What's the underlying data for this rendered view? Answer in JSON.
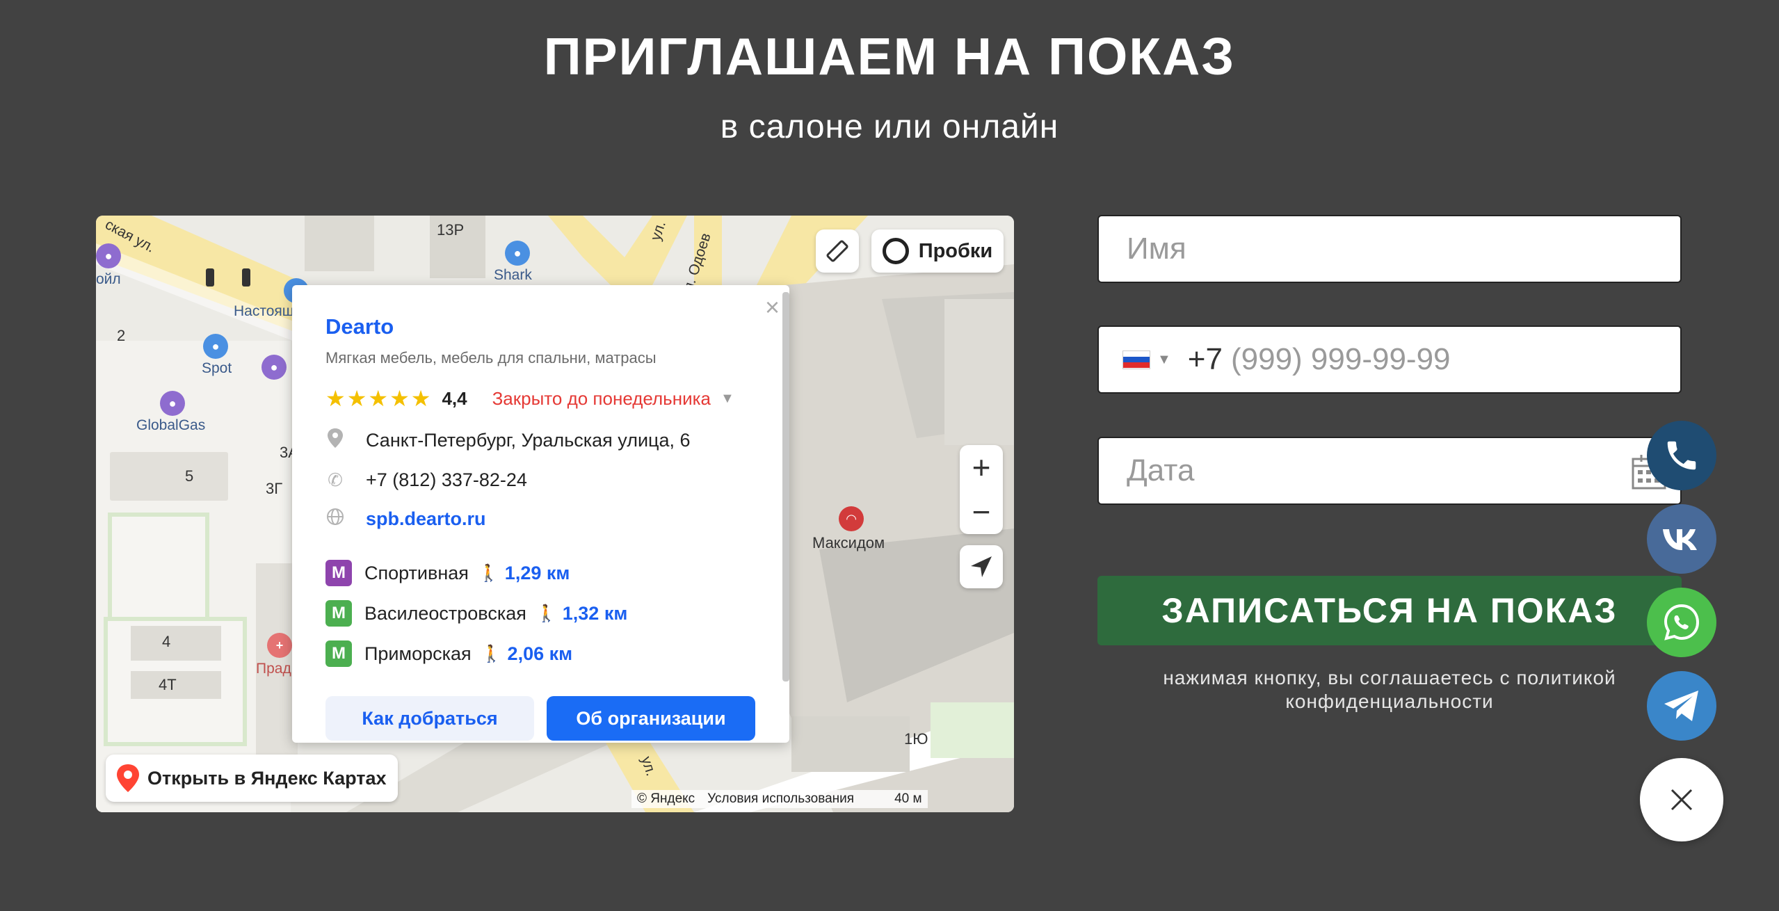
{
  "header": {
    "title": "ПРИГЛАШАЕМ НА ПОКАЗ",
    "subtitle": "в салоне или онлайн"
  },
  "map": {
    "traffic_label": "Пробки",
    "zoom_in": "+",
    "zoom_out": "−",
    "open_in_maps": "Открыть в Яндекс Картах",
    "copyright": "© Яндекс",
    "terms": "Условия использования",
    "scale": "40 м",
    "labels": {
      "street1": "ская ул.",
      "street2": "ул. Одоев",
      "street3": "ул.",
      "street4": "ул.",
      "b13p": "13Р",
      "shark": "Shark",
      "nastoyash": "Настоящ",
      "spot": "Spot",
      "globalgas": "GlobalGas",
      "b2": "2",
      "b5": "5",
      "b3a": "3А",
      "b3g": "3Г",
      "b4": "4",
      "b4t": "4Т",
      "prad": "Прад",
      "maxidom": "Максидом",
      "b1yu": "1Ю",
      "oil": "ойл"
    },
    "card": {
      "name": "Dearto",
      "category": "Мягкая мебель, мебель для спальни, матрасы",
      "rating": "4,4",
      "stars": "★★★★★",
      "status": "Закрыто до понедельника",
      "address": "Санкт-Петербург, Уральская улица, 6",
      "phone": "+7 (812) 337-82-24",
      "site": "spb.dearto.ru",
      "metro": [
        {
          "badge": "М",
          "name": "Спортивная",
          "distance": "1,29 км",
          "color": "#8e44ad"
        },
        {
          "badge": "М",
          "name": "Василеостровская",
          "distance": "1,32 км",
          "color": "#4caf50"
        },
        {
          "badge": "М",
          "name": "Приморская",
          "distance": "2,06 км",
          "color": "#4caf50"
        }
      ],
      "route_button": "Как добраться",
      "about_button": "Об организации"
    }
  },
  "form": {
    "name_placeholder": "Имя",
    "phone_prefix": "+7",
    "phone_placeholder": "(999) 999-99-99",
    "date_placeholder": "Дата",
    "submit_label": "ЗАПИСАТЬСЯ НА ПОКАЗ",
    "consent": "нажимая кнопку, вы соглашаетесь с политикой конфиденциальности"
  },
  "colors": {
    "background": "#424242",
    "submit": "#2e6b3d",
    "link": "#1a5ff0",
    "status_closed": "#e53935"
  }
}
